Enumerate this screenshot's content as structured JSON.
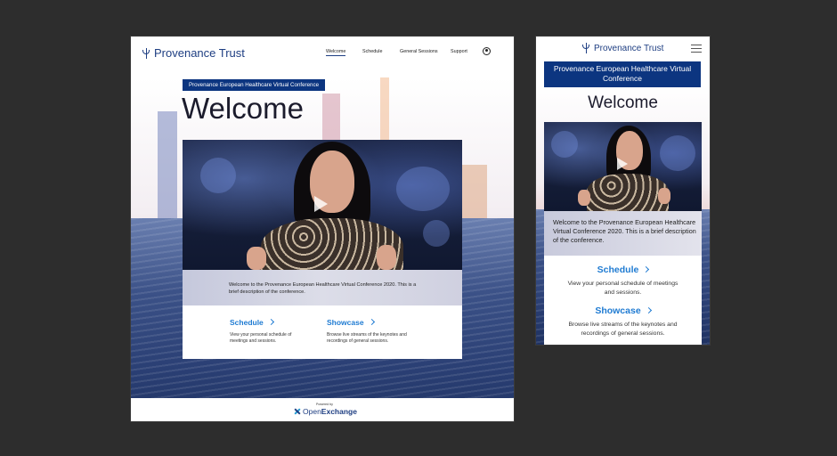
{
  "brand": {
    "name": "Provenance Trust",
    "accent": "#1e3e82",
    "link_color": "#1f7bd2",
    "badge_color": "#0c3580"
  },
  "nav": {
    "items": [
      "Welcome",
      "Schedule",
      "General Sessions",
      "Support"
    ],
    "active": "Welcome"
  },
  "hero": {
    "badge": "Provenance European Healthcare Virtual Conference",
    "title": "Welcome",
    "description": "Welcome to the Provenance European Healthcare Virtual Conference 2020. This is a brief description of the conference."
  },
  "cards": [
    {
      "title": "Schedule",
      "text": "View your personal schedule of meetings and sessions."
    },
    {
      "title": "Showcase",
      "text": "Browse live streams of the keynotes and recordings of general sessions."
    }
  ],
  "footer": {
    "powered_by": "Powered by",
    "logo_text_a": "Open",
    "logo_text_b": "Exchange"
  },
  "icons": {
    "user": "user-circle-icon",
    "menu": "hamburger-menu-icon",
    "play": "play-icon",
    "chevron": "chevron-right-icon"
  }
}
